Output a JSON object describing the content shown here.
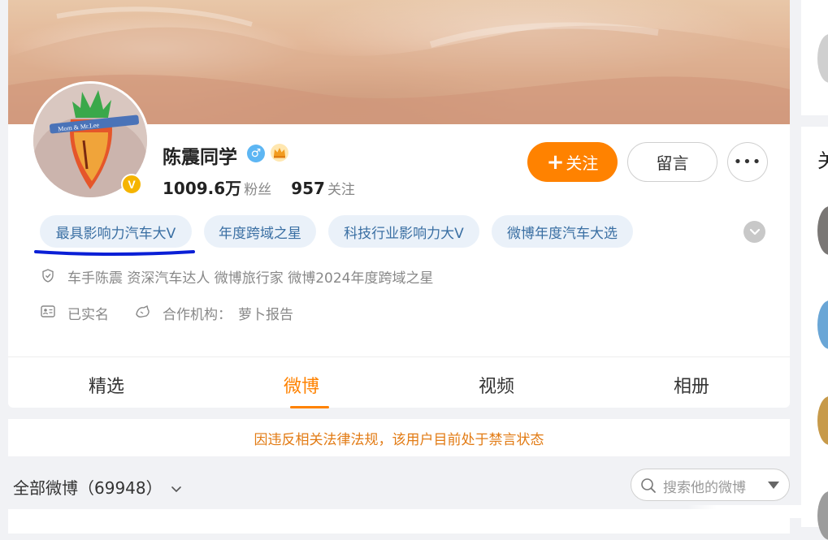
{
  "profile": {
    "name": "陈震同学",
    "gender_symbol": "♂",
    "verified_badge": "V",
    "followers_count": "1009.6万",
    "followers_label": "粉丝",
    "following_count": "957",
    "following_label": "关注"
  },
  "actions": {
    "follow_plus": "+",
    "follow_label": "关注",
    "message_label": "留言",
    "more_label": "•••"
  },
  "tags": [
    "最具影响力汽车大V",
    "年度跨域之星",
    "科技行业影响力大V",
    "微博年度汽车大选"
  ],
  "info": {
    "description": "车手陈震 资深汽车达人 微博旅行家 微博2024年度跨域之星",
    "real_name": "已实名",
    "partner_label": "合作机构：",
    "partner_name": "萝卜报告"
  },
  "tabs": [
    {
      "label": "精选",
      "active": false
    },
    {
      "label": "微博",
      "active": true
    },
    {
      "label": "视频",
      "active": false
    },
    {
      "label": "相册",
      "active": false
    }
  ],
  "notice": "因违反相关法律法规，该用户目前处于禁言状态",
  "feed": {
    "all_label": "全部微博（69948）",
    "search_placeholder": "搜索他的微博"
  },
  "right_column": {
    "header_char": "关"
  },
  "colors": {
    "accent": "#ff8200",
    "tag_bg": "#eaf1f9",
    "tag_text": "#3a6fa3",
    "notice_text": "#e27b14",
    "gender_blue": "#5db6f3",
    "verified_gold": "#f5b400",
    "annotation_underline": "#0a1fd6"
  },
  "icons": [
    "shield-icon",
    "id-card-icon",
    "partner-icon",
    "search-icon",
    "chevron-down-icon",
    "crown-icon"
  ]
}
